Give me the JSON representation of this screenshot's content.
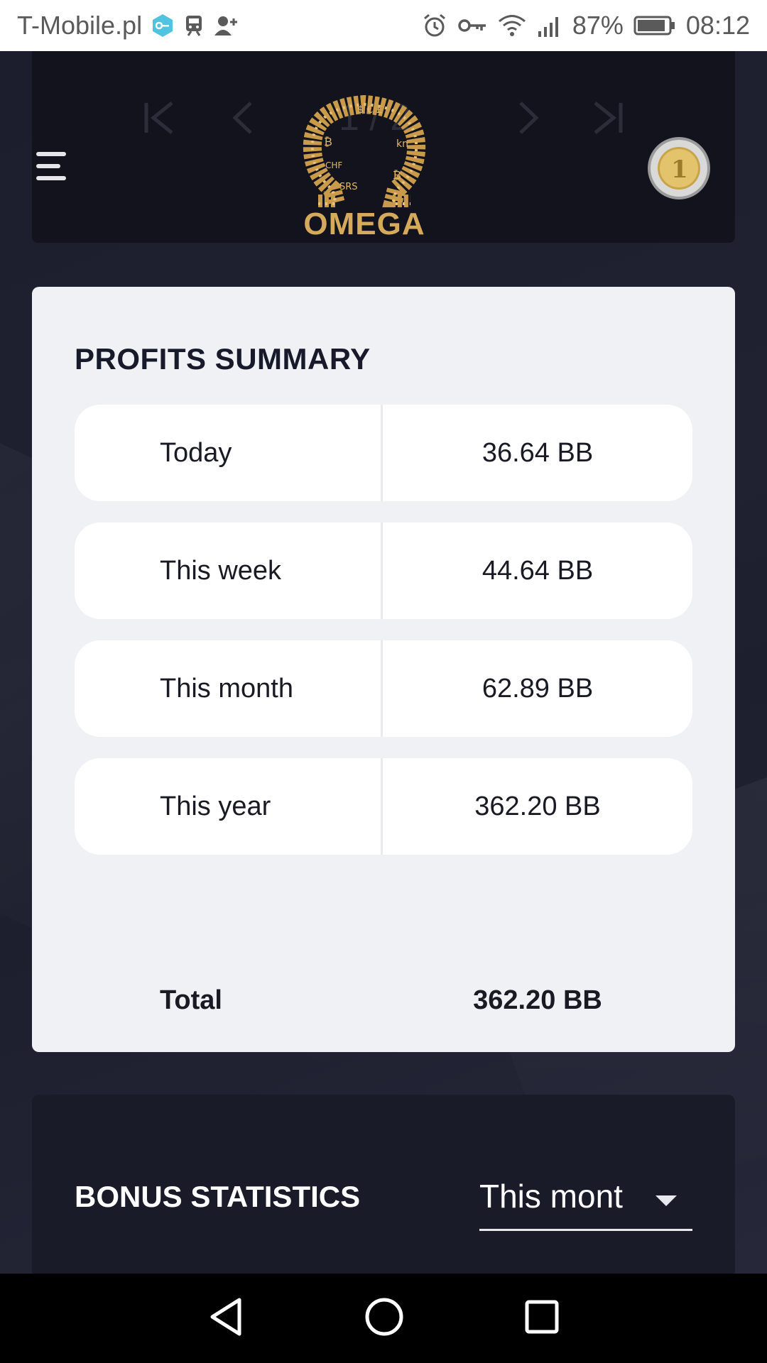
{
  "status_bar": {
    "carrier": "T-Mobile.pl",
    "battery": "87%",
    "time": "08:12",
    "icons": [
      "vpn-key-icon",
      "train-icon",
      "add-person-icon",
      "alarm-icon",
      "key-icon",
      "wifi-icon",
      "signal-icon",
      "battery-icon"
    ]
  },
  "header": {
    "pager_text": "1 / 2",
    "logo_text": "OMEGA",
    "menu_icon": "hamburger-icon",
    "avatar_icon": "euro-coin-icon"
  },
  "profits": {
    "title": "PROFITS SUMMARY",
    "rows": [
      {
        "label": "Today",
        "value": "36.64 BB"
      },
      {
        "label": "This week",
        "value": "44.64 BB"
      },
      {
        "label": "This month",
        "value": "62.89 BB"
      },
      {
        "label": "This year",
        "value": "362.20 BB"
      }
    ],
    "total": {
      "label": "Total",
      "value": "362.20 BB"
    }
  },
  "bonus": {
    "title": "BONUS STATISTICS",
    "period_select": "This mont"
  },
  "colors": {
    "accent_gold": "#d6aa5b",
    "card_bg": "#f0f1f4",
    "app_bg": "#1b1d2b"
  }
}
